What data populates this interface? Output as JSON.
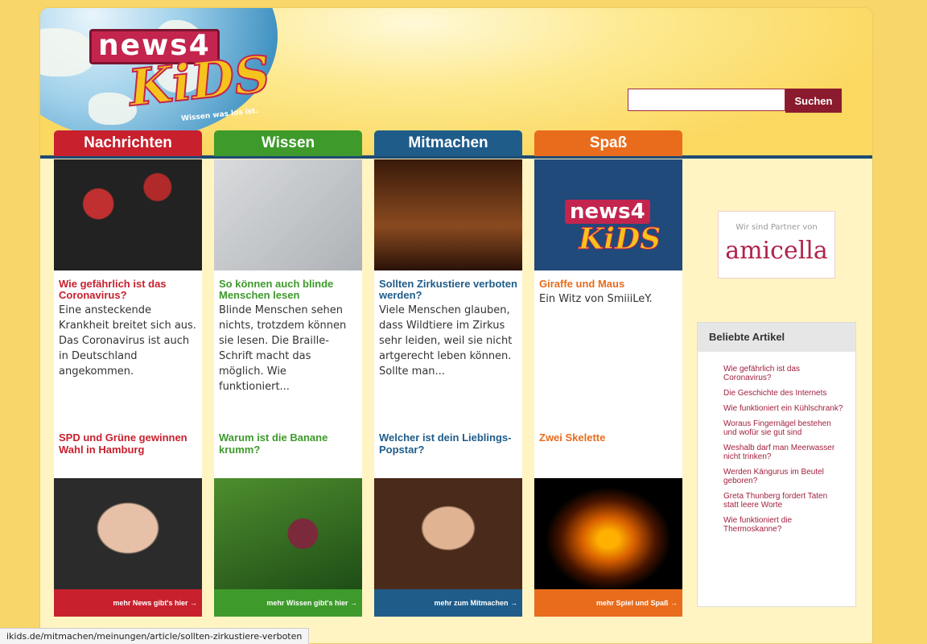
{
  "logo": {
    "top": "news4",
    "kids": "KiDS",
    "tagline": "Wissen was los ist."
  },
  "search": {
    "placeholder": "",
    "button": "Suchen"
  },
  "tabs": [
    {
      "label": "Nachrichten",
      "color": "#c8202d"
    },
    {
      "label": "Wissen",
      "color": "#3d9a2b"
    },
    {
      "label": "Mitmachen",
      "color": "#1f5c8a"
    },
    {
      "label": "Spaß",
      "color": "#e86c1c"
    }
  ],
  "columns": [
    {
      "headline": "Wie gefährlich ist das Coronavirus?",
      "teaser": "Eine ansteckende Krankheit breitet sich aus. Das Coronavirus ist auch in Deutschland angekommen.",
      "headline2": "SPD und Grüne gewinnen Wahl in Hamburg",
      "more": "mehr News gibt's hier →",
      "color": "#c8202d"
    },
    {
      "headline": "So können auch blinde Menschen lesen",
      "teaser": "Blinde Menschen sehen nichts, trotzdem können sie lesen. Die Braille-Schrift macht das möglich. Wie funktioniert...",
      "headline2": "Warum ist die Banane krumm?",
      "more": "mehr Wissen gibt's hier →",
      "color": "#3d9a2b"
    },
    {
      "headline": "Sollten Zirkustiere verboten werden?",
      "teaser": "Viele Menschen glauben, dass Wildtiere im Zirkus sehr leiden, weil sie nicht artgerecht leben können. Sollte man...",
      "headline2": "Welcher ist dein Lieblings-Popstar?",
      "more": "mehr zum Mitmachen →",
      "color": "#1f5c8a"
    },
    {
      "headline": "Giraffe und Maus",
      "teaser": "Ein Witz von SmiiiLeY.",
      "headline2": "Zwei Skelette",
      "more": "mehr Spiel und Spaß →",
      "color": "#e86c1c"
    }
  ],
  "partner": {
    "label": "Wir sind Partner von",
    "name": "amicella"
  },
  "popular": {
    "title": "Beliebte Artikel",
    "items": [
      "Wie gefährlich ist das Coronavirus?",
      "Die Geschichte des Internets",
      "Wie funktioniert ein Kühlschrank?",
      "Woraus Fingernägel bestehen und wofür sie gut sind",
      "Weshalb darf man Meerwasser nicht trinken?",
      "Werden Kängurus im Beutel geboren?",
      "Greta Thunberg fordert Taten statt leere Worte",
      "Wie funktioniert die Thermoskanne?"
    ]
  },
  "status_url": "ikids.de/mitmachen/meinungen/article/sollten-zirkustiere-verboten"
}
